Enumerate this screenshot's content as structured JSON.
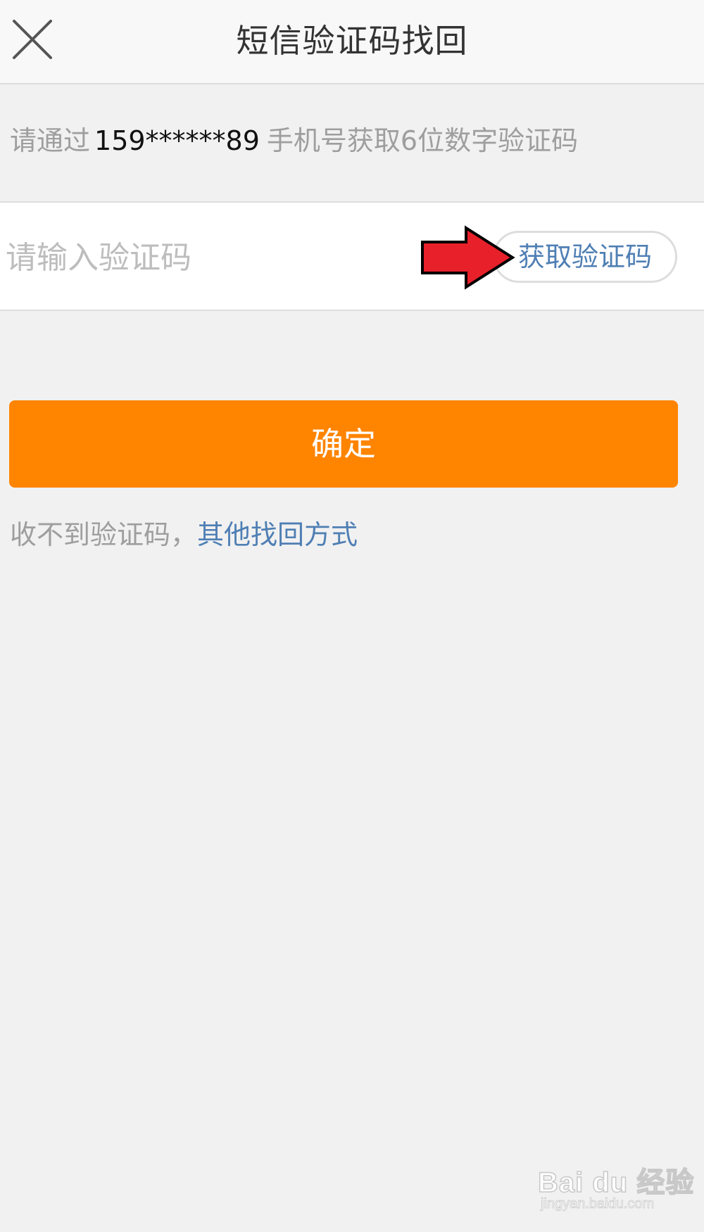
{
  "header": {
    "title": "短信验证码找回",
    "close_icon": "close-icon"
  },
  "hint": {
    "prefix": "请通过",
    "phone": "159******89",
    "suffix": "手机号获取6位数字验证码"
  },
  "code_field": {
    "placeholder": "请输入验证码",
    "value": "",
    "get_code_label": "获取验证码"
  },
  "annotation": {
    "arrow_icon": "red-arrow-icon",
    "color": "#e8202a"
  },
  "confirm": {
    "label": "确定"
  },
  "alternative": {
    "text": "收不到验证码，",
    "link_label": "其他找回方式"
  },
  "watermark": {
    "logo": "Bai du 经验",
    "url": "jingyan.baidu.com"
  },
  "colors": {
    "accent": "#ff8400",
    "link": "#4f7fb4",
    "background": "#f1f1f1"
  }
}
